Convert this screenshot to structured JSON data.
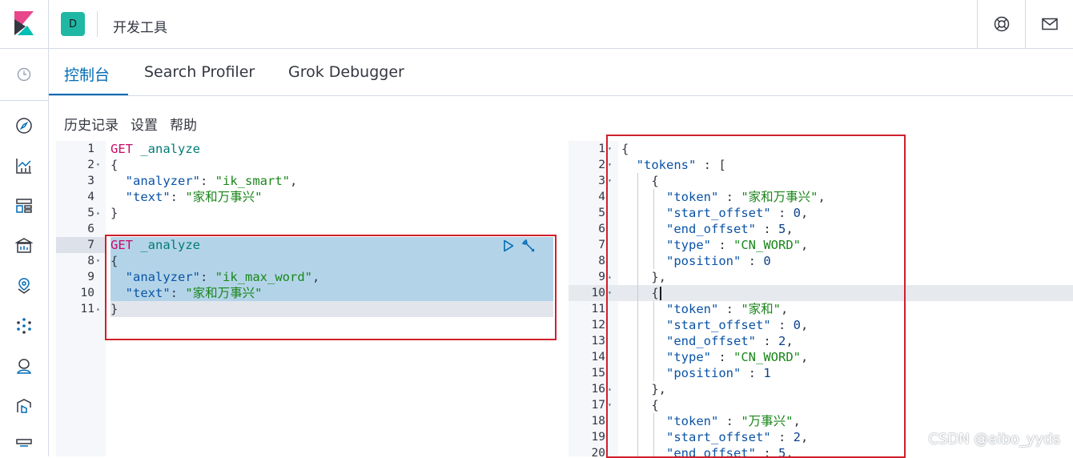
{
  "header": {
    "space_initial": "D",
    "app_title": "开发工具"
  },
  "tabs": [
    {
      "label": "控制台",
      "active": true
    },
    {
      "label": "Search Profiler",
      "active": false
    },
    {
      "label": "Grok Debugger",
      "active": false
    }
  ],
  "toolbar": {
    "history": "历史记录",
    "settings": "设置",
    "help": "帮助"
  },
  "request_editor": {
    "line_numbers": [
      "1",
      "2",
      "3",
      "4",
      "5",
      "6",
      "7",
      "8",
      "9",
      "10",
      "11"
    ],
    "lines": [
      [
        [
          "k-get",
          "GET"
        ],
        [
          "k-pun",
          " "
        ],
        [
          "k-path",
          "_analyze"
        ]
      ],
      [
        [
          "k-pun",
          "{"
        ]
      ],
      [
        [
          "k-pun",
          "  "
        ],
        [
          "k-key",
          "\"analyzer\""
        ],
        [
          "k-pun",
          ": "
        ],
        [
          "k-str",
          "\"ik_smart\""
        ],
        [
          "k-pun",
          ","
        ]
      ],
      [
        [
          "k-pun",
          "  "
        ],
        [
          "k-key",
          "\"text\""
        ],
        [
          "k-pun",
          ": "
        ],
        [
          "k-str",
          "\"家和万事兴\""
        ]
      ],
      [
        [
          "k-pun",
          "}"
        ]
      ],
      [],
      [
        [
          "k-get",
          "GET"
        ],
        [
          "k-pun",
          " "
        ],
        [
          "k-path",
          "_analyze"
        ]
      ],
      [
        [
          "k-pun",
          "{"
        ]
      ],
      [
        [
          "k-pun",
          "  "
        ],
        [
          "k-key",
          "\"analyzer\""
        ],
        [
          "k-pun",
          ": "
        ],
        [
          "k-str",
          "\"ik_max_word\""
        ],
        [
          "k-pun",
          ","
        ]
      ],
      [
        [
          "k-pun",
          "  "
        ],
        [
          "k-key",
          "\"text\""
        ],
        [
          "k-pun",
          ": "
        ],
        [
          "k-str",
          "\"家和万事兴\""
        ]
      ],
      [
        [
          "k-pun",
          "}"
        ]
      ]
    ]
  },
  "response_editor": {
    "line_numbers": [
      "1",
      "2",
      "3",
      "4",
      "5",
      "6",
      "7",
      "8",
      "9",
      "10",
      "11",
      "12",
      "13",
      "14",
      "15",
      "16",
      "17",
      "18",
      "19",
      "20"
    ],
    "lines": [
      [
        [
          "k-pun",
          "{"
        ]
      ],
      [
        [
          "k-pun",
          "  "
        ],
        [
          "k-key",
          "\"tokens\""
        ],
        [
          "k-pun",
          " : ["
        ]
      ],
      [
        [
          "k-pun",
          "    {"
        ]
      ],
      [
        [
          "k-pun",
          "      "
        ],
        [
          "k-key",
          "\"token\""
        ],
        [
          "k-pun",
          " : "
        ],
        [
          "k-str",
          "\"家和万事兴\""
        ],
        [
          "k-pun",
          ","
        ]
      ],
      [
        [
          "k-pun",
          "      "
        ],
        [
          "k-key",
          "\"start_offset\""
        ],
        [
          "k-pun",
          " : "
        ],
        [
          "k-num",
          "0"
        ],
        [
          "k-pun",
          ","
        ]
      ],
      [
        [
          "k-pun",
          "      "
        ],
        [
          "k-key",
          "\"end_offset\""
        ],
        [
          "k-pun",
          " : "
        ],
        [
          "k-num",
          "5"
        ],
        [
          "k-pun",
          ","
        ]
      ],
      [
        [
          "k-pun",
          "      "
        ],
        [
          "k-key",
          "\"type\""
        ],
        [
          "k-pun",
          " : "
        ],
        [
          "k-str",
          "\"CN_WORD\""
        ],
        [
          "k-pun",
          ","
        ]
      ],
      [
        [
          "k-pun",
          "      "
        ],
        [
          "k-key",
          "\"position\""
        ],
        [
          "k-pun",
          " : "
        ],
        [
          "k-num",
          "0"
        ]
      ],
      [
        [
          "k-pun",
          "    },"
        ]
      ],
      [
        [
          "k-pun",
          "    {"
        ]
      ],
      [
        [
          "k-pun",
          "      "
        ],
        [
          "k-key",
          "\"token\""
        ],
        [
          "k-pun",
          " : "
        ],
        [
          "k-str",
          "\"家和\""
        ],
        [
          "k-pun",
          ","
        ]
      ],
      [
        [
          "k-pun",
          "      "
        ],
        [
          "k-key",
          "\"start_offset\""
        ],
        [
          "k-pun",
          " : "
        ],
        [
          "k-num",
          "0"
        ],
        [
          "k-pun",
          ","
        ]
      ],
      [
        [
          "k-pun",
          "      "
        ],
        [
          "k-key",
          "\"end_offset\""
        ],
        [
          "k-pun",
          " : "
        ],
        [
          "k-num",
          "2"
        ],
        [
          "k-pun",
          ","
        ]
      ],
      [
        [
          "k-pun",
          "      "
        ],
        [
          "k-key",
          "\"type\""
        ],
        [
          "k-pun",
          " : "
        ],
        [
          "k-str",
          "\"CN_WORD\""
        ],
        [
          "k-pun",
          ","
        ]
      ],
      [
        [
          "k-pun",
          "      "
        ],
        [
          "k-key",
          "\"position\""
        ],
        [
          "k-pun",
          " : "
        ],
        [
          "k-num",
          "1"
        ]
      ],
      [
        [
          "k-pun",
          "    },"
        ]
      ],
      [
        [
          "k-pun",
          "    {"
        ]
      ],
      [
        [
          "k-pun",
          "      "
        ],
        [
          "k-key",
          "\"token\""
        ],
        [
          "k-pun",
          " : "
        ],
        [
          "k-str",
          "\"万事兴\""
        ],
        [
          "k-pun",
          ","
        ]
      ],
      [
        [
          "k-pun",
          "      "
        ],
        [
          "k-key",
          "\"start_offset\""
        ],
        [
          "k-pun",
          " : "
        ],
        [
          "k-num",
          "2"
        ],
        [
          "k-pun",
          ","
        ]
      ],
      [
        [
          "k-pun",
          "      "
        ],
        [
          "k-key",
          "\"end_offset\""
        ],
        [
          "k-pun",
          " : "
        ],
        [
          "k-num",
          "5"
        ],
        [
          "k-pun",
          ","
        ]
      ]
    ]
  },
  "watermark": "CSDN @aibo_yyds",
  "icons": {
    "logo": "kibana-logo-icon",
    "help": "help-lifebuoy-icon",
    "mail": "mail-icon",
    "recent": "clock-icon",
    "nav": [
      "discover-compass-icon",
      "visualize-icon",
      "dashboard-icon",
      "canvas-icon",
      "maps-icon",
      "ml-icon",
      "graph-icon",
      "security-icon",
      "observability-icon"
    ],
    "run": "play-icon",
    "wrench": "wrench-icon"
  },
  "colors": {
    "accent": "#006bb4",
    "space_badge": "#20b8a4",
    "selection": "#b3d4e8",
    "annotation_box": "#d0202c"
  }
}
